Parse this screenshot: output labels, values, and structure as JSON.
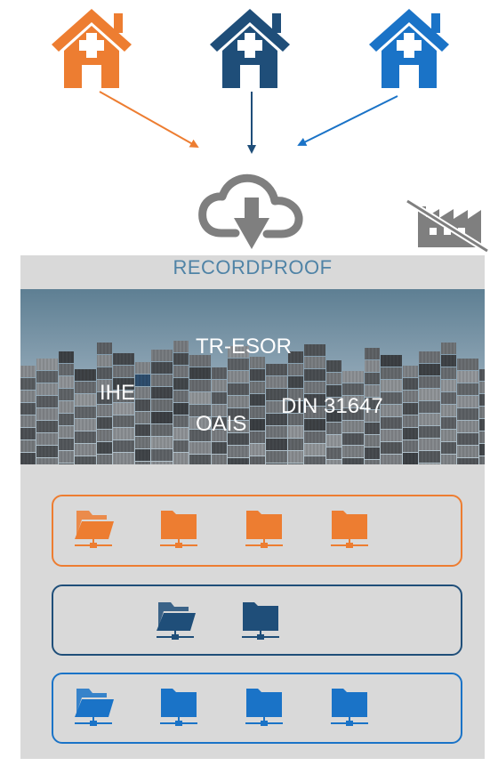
{
  "title": "RECORDPROOF",
  "standards": [
    "TR-ESOR",
    "IHE",
    "OAIS",
    "DIN 31647"
  ],
  "colors": {
    "orange": "#ed7d31",
    "navy": "#1f4e79",
    "blue": "#1a73c7",
    "gray_icon": "#7f7f7f",
    "panel": "#d9d9d9",
    "title": "#4f83a6"
  },
  "icons": {
    "sources": [
      "hospital-icon",
      "hospital-icon",
      "hospital-icon"
    ],
    "cloud": "cloud-download-icon",
    "factory": "factory-crossed-icon",
    "folder_open": "folder-open-network-icon",
    "folder_closed": "folder-network-icon"
  },
  "groups": [
    {
      "color": "orange",
      "folders": [
        "open",
        "closed",
        "closed",
        "closed"
      ]
    },
    {
      "color": "navy",
      "folders": [
        "open",
        "closed"
      ]
    },
    {
      "color": "blue",
      "folders": [
        "open",
        "closed",
        "closed",
        "closed"
      ]
    }
  ]
}
